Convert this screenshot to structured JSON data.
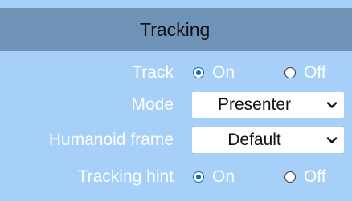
{
  "panel": {
    "title": "Tracking",
    "colors": {
      "panel_background": "#a6d0f7",
      "header_background": "#6f93b6",
      "radio_accent": "#1464cc"
    }
  },
  "track": {
    "label": "Track",
    "options": [
      {
        "label": "On",
        "checked": true
      },
      {
        "label": "Off",
        "checked": false
      }
    ]
  },
  "mode": {
    "label": "Mode",
    "selected": "Presenter",
    "icon": "chevron-down-icon"
  },
  "humanoid_frame": {
    "label": "Humanoid frame",
    "selected": "Default",
    "icon": "chevron-down-icon"
  },
  "tracking_hint": {
    "label": "Tracking hint",
    "options": [
      {
        "label": "On",
        "checked": true
      },
      {
        "label": "Off",
        "checked": false
      }
    ]
  }
}
